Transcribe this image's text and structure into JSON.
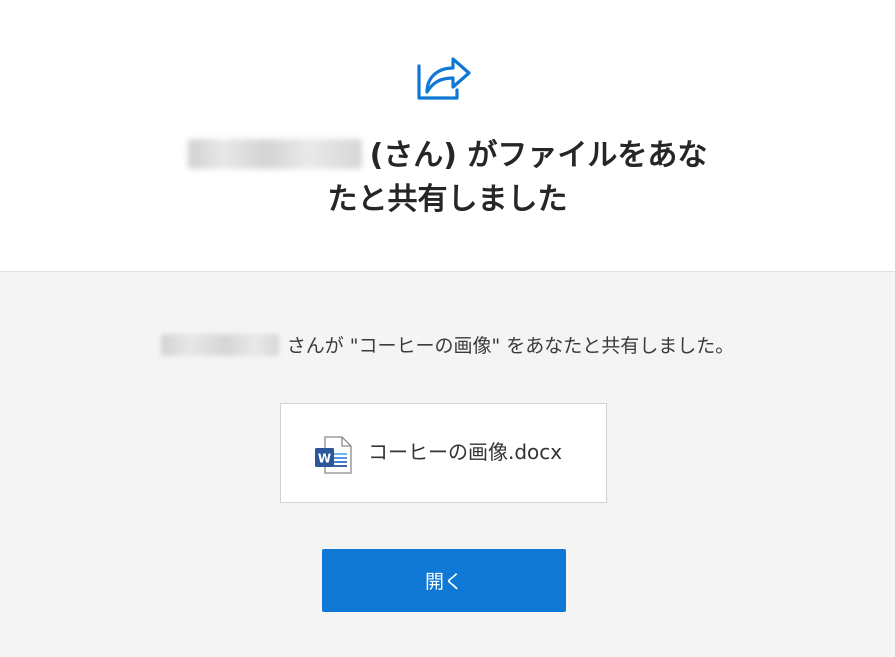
{
  "header": {
    "icon": "share-icon",
    "title_line1_suffix": "(さん) がファイルをあな",
    "title_line2": "たと共有しました"
  },
  "body": {
    "message": "さんが \"コーヒーの画像\" をあなたと共有しました。",
    "file": {
      "icon": "word-document-icon",
      "name": "コーヒーの画像.docx"
    },
    "open_button_label": "開く"
  },
  "colors": {
    "accent": "#0f78d4",
    "word_blue": "#2b579a",
    "bottom_background": "#f4f4f4"
  }
}
